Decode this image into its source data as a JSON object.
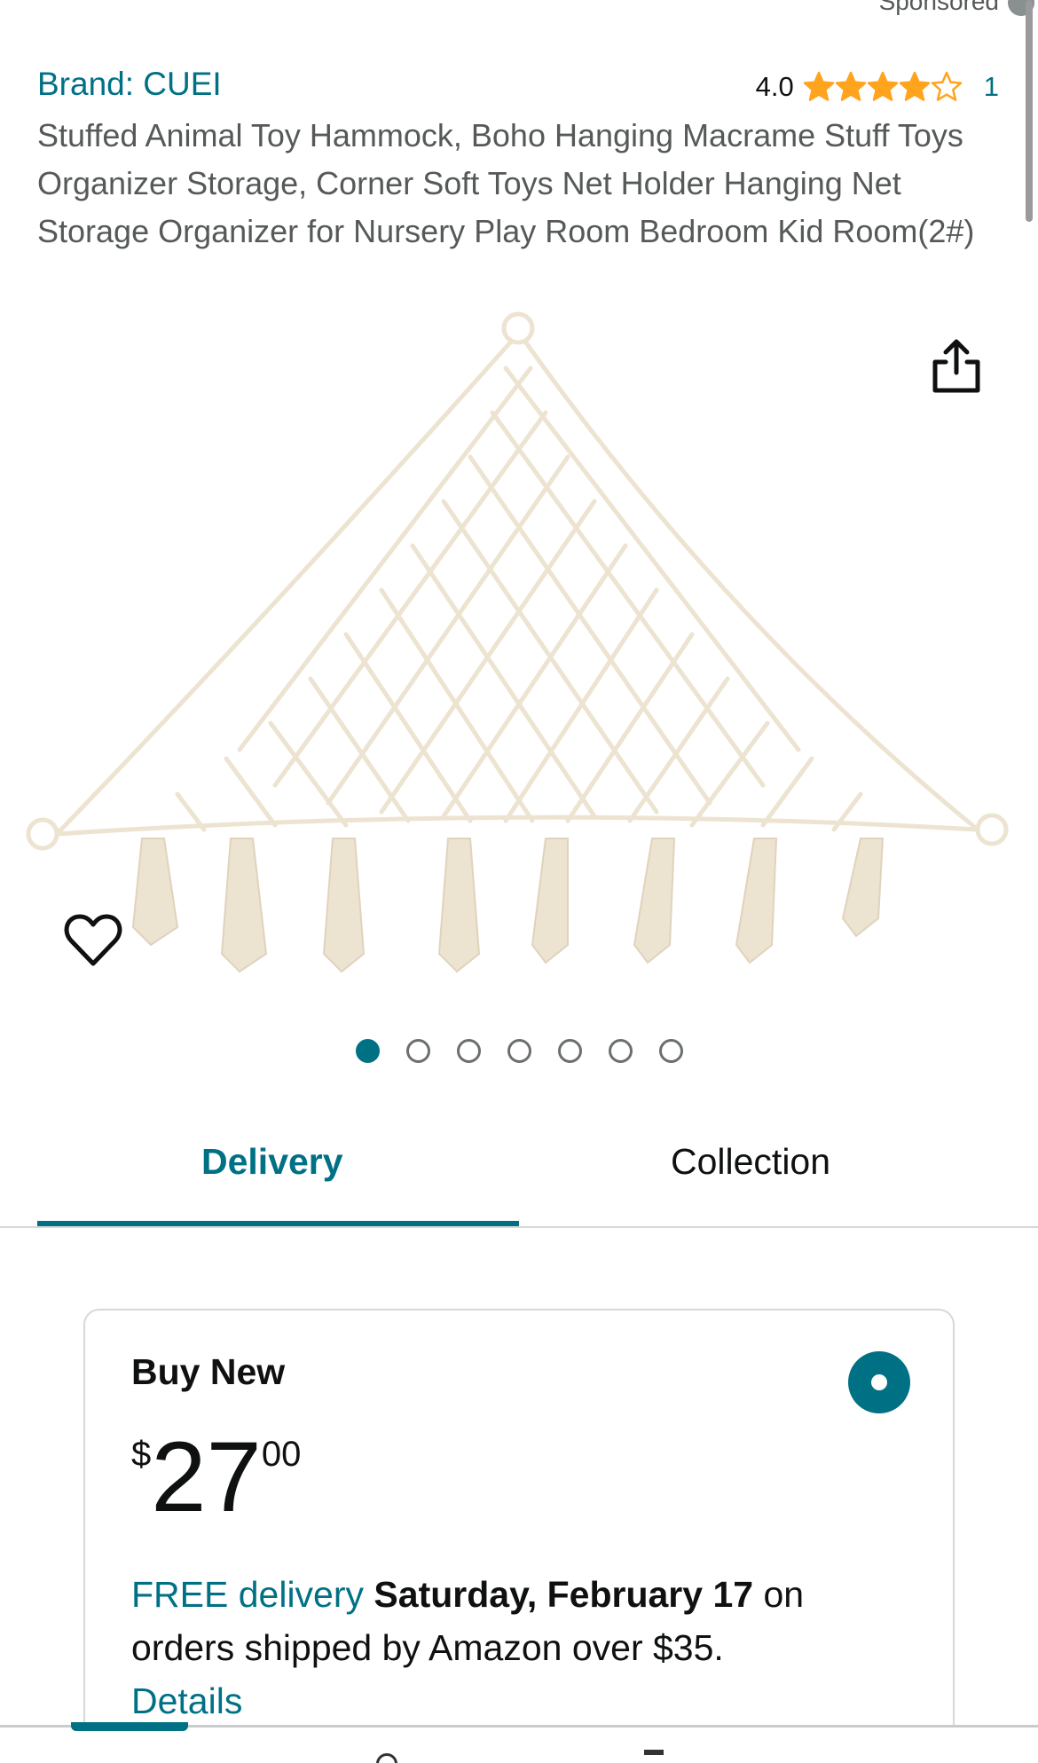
{
  "header": {
    "sponsored_label": "Sponsored"
  },
  "product": {
    "brand": "Brand: CUEI",
    "rating_value": "4.0",
    "rating_stars": 4,
    "rating_max": 5,
    "rating_count": "1",
    "title": "Stuffed Animal Toy Hammock, Boho Hanging Macrame Stuff Toys Organizer Storage, Corner Soft Toys Net Holder Hanging Net Storage Organizer for Nursery Play Room Bedroom Kid Room(2#)",
    "image_count": 7,
    "active_image_index": 0
  },
  "icons": {
    "share": "share-icon",
    "wishlist": "heart-icon",
    "star": "star-icon"
  },
  "tabs": [
    {
      "label": "Delivery",
      "active": true
    },
    {
      "label": "Collection",
      "active": false
    }
  ],
  "buy_box": {
    "title": "Buy New",
    "price_symbol": "$",
    "price_whole": "27",
    "price_fraction": "00",
    "free_delivery_label": "FREE delivery",
    "delivery_date": "Saturday, February 17",
    "delivery_rest": "on orders shipped by Amazon over $35.",
    "details_label": "Details",
    "selected": true
  },
  "colors": {
    "accent": "#007185",
    "star": "#ffa41c",
    "text": "#0f1111",
    "muted": "#565959"
  }
}
